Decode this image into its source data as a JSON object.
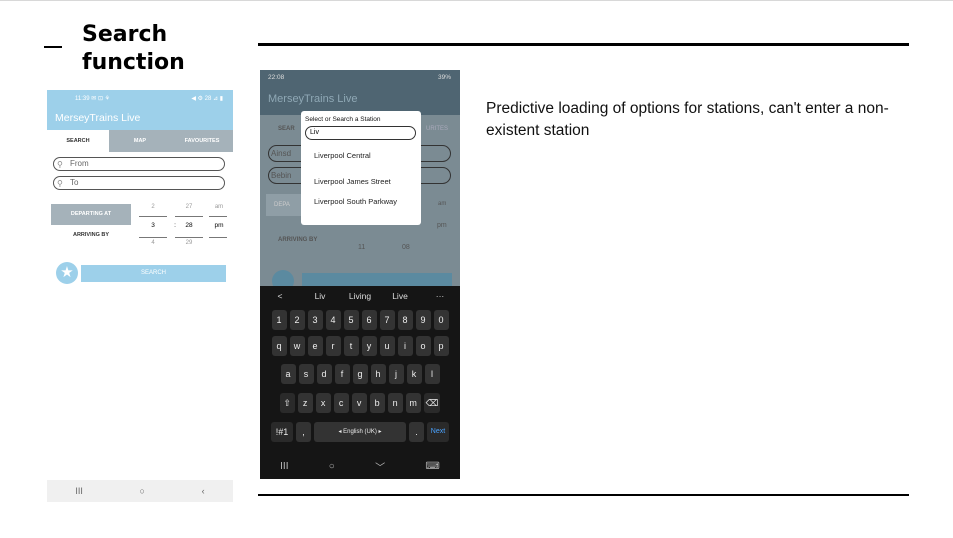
{
  "slide": {
    "title": "Search function",
    "caption": "Predictive loading of options for stations, can't enter a non-existent station"
  },
  "phone1": {
    "status_time": "11:39",
    "status_icons": "✉ ⊡ ⚘",
    "status_right": "◀ ⚙ 28 ⊿ ▮",
    "app_title": "MerseyTrains Live",
    "tabs": [
      "SEARCH",
      "MAP",
      "FAVOURITES"
    ],
    "from_placeholder": "From",
    "to_placeholder": "To",
    "departing_label": "DEPARTING AT",
    "arriving_label": "ARRIVING BY",
    "hour_prev": "2",
    "hour_sel": "3",
    "hour_next": "4",
    "min_prev": "27",
    "min_sel": "28",
    "min_next": "29",
    "ampm_prev": "am",
    "ampm_sel": "pm",
    "search_button": "SEARCH",
    "nav": [
      "III",
      "○",
      "‹"
    ]
  },
  "phone2": {
    "status_time": "22:08",
    "status_right": "39%",
    "app_title": "MerseyTrains Live",
    "ghost_search": "SEAR",
    "ghost_fav": "URITES",
    "ghost_from": "Ainsd",
    "ghost_to": "Bebin",
    "ghost_depart": "DEPA",
    "ghost_arrive": "ARRIVING BY",
    "ghost_pm": "pm",
    "ghost_am": "am",
    "ghost_11": "11",
    "ghost_08": "08",
    "modal_title": "Select or Search a Station",
    "modal_input": "Liv",
    "options": [
      "Liverpool Central",
      "Liverpool James Street",
      "Liverpool South Parkway"
    ],
    "suggestions": [
      "<",
      "Liv",
      "Living",
      "Live",
      "···"
    ],
    "row_numbers": [
      "1",
      "2",
      "3",
      "4",
      "5",
      "6",
      "7",
      "8",
      "9",
      "0"
    ],
    "row_q": [
      "q",
      "w",
      "e",
      "r",
      "t",
      "y",
      "u",
      "i",
      "o",
      "p"
    ],
    "row_a": [
      "a",
      "s",
      "d",
      "f",
      "g",
      "h",
      "j",
      "k",
      "l"
    ],
    "row_z": [
      "⇧",
      "z",
      "x",
      "c",
      "v",
      "b",
      "n",
      "m",
      "⌫"
    ],
    "sym_key": "!#1",
    "comma_key": ",",
    "space_key": "English (UK)",
    "period_key": ".",
    "next_key": "Next",
    "nav": [
      "III",
      "○",
      "﹀",
      "⌨"
    ]
  }
}
